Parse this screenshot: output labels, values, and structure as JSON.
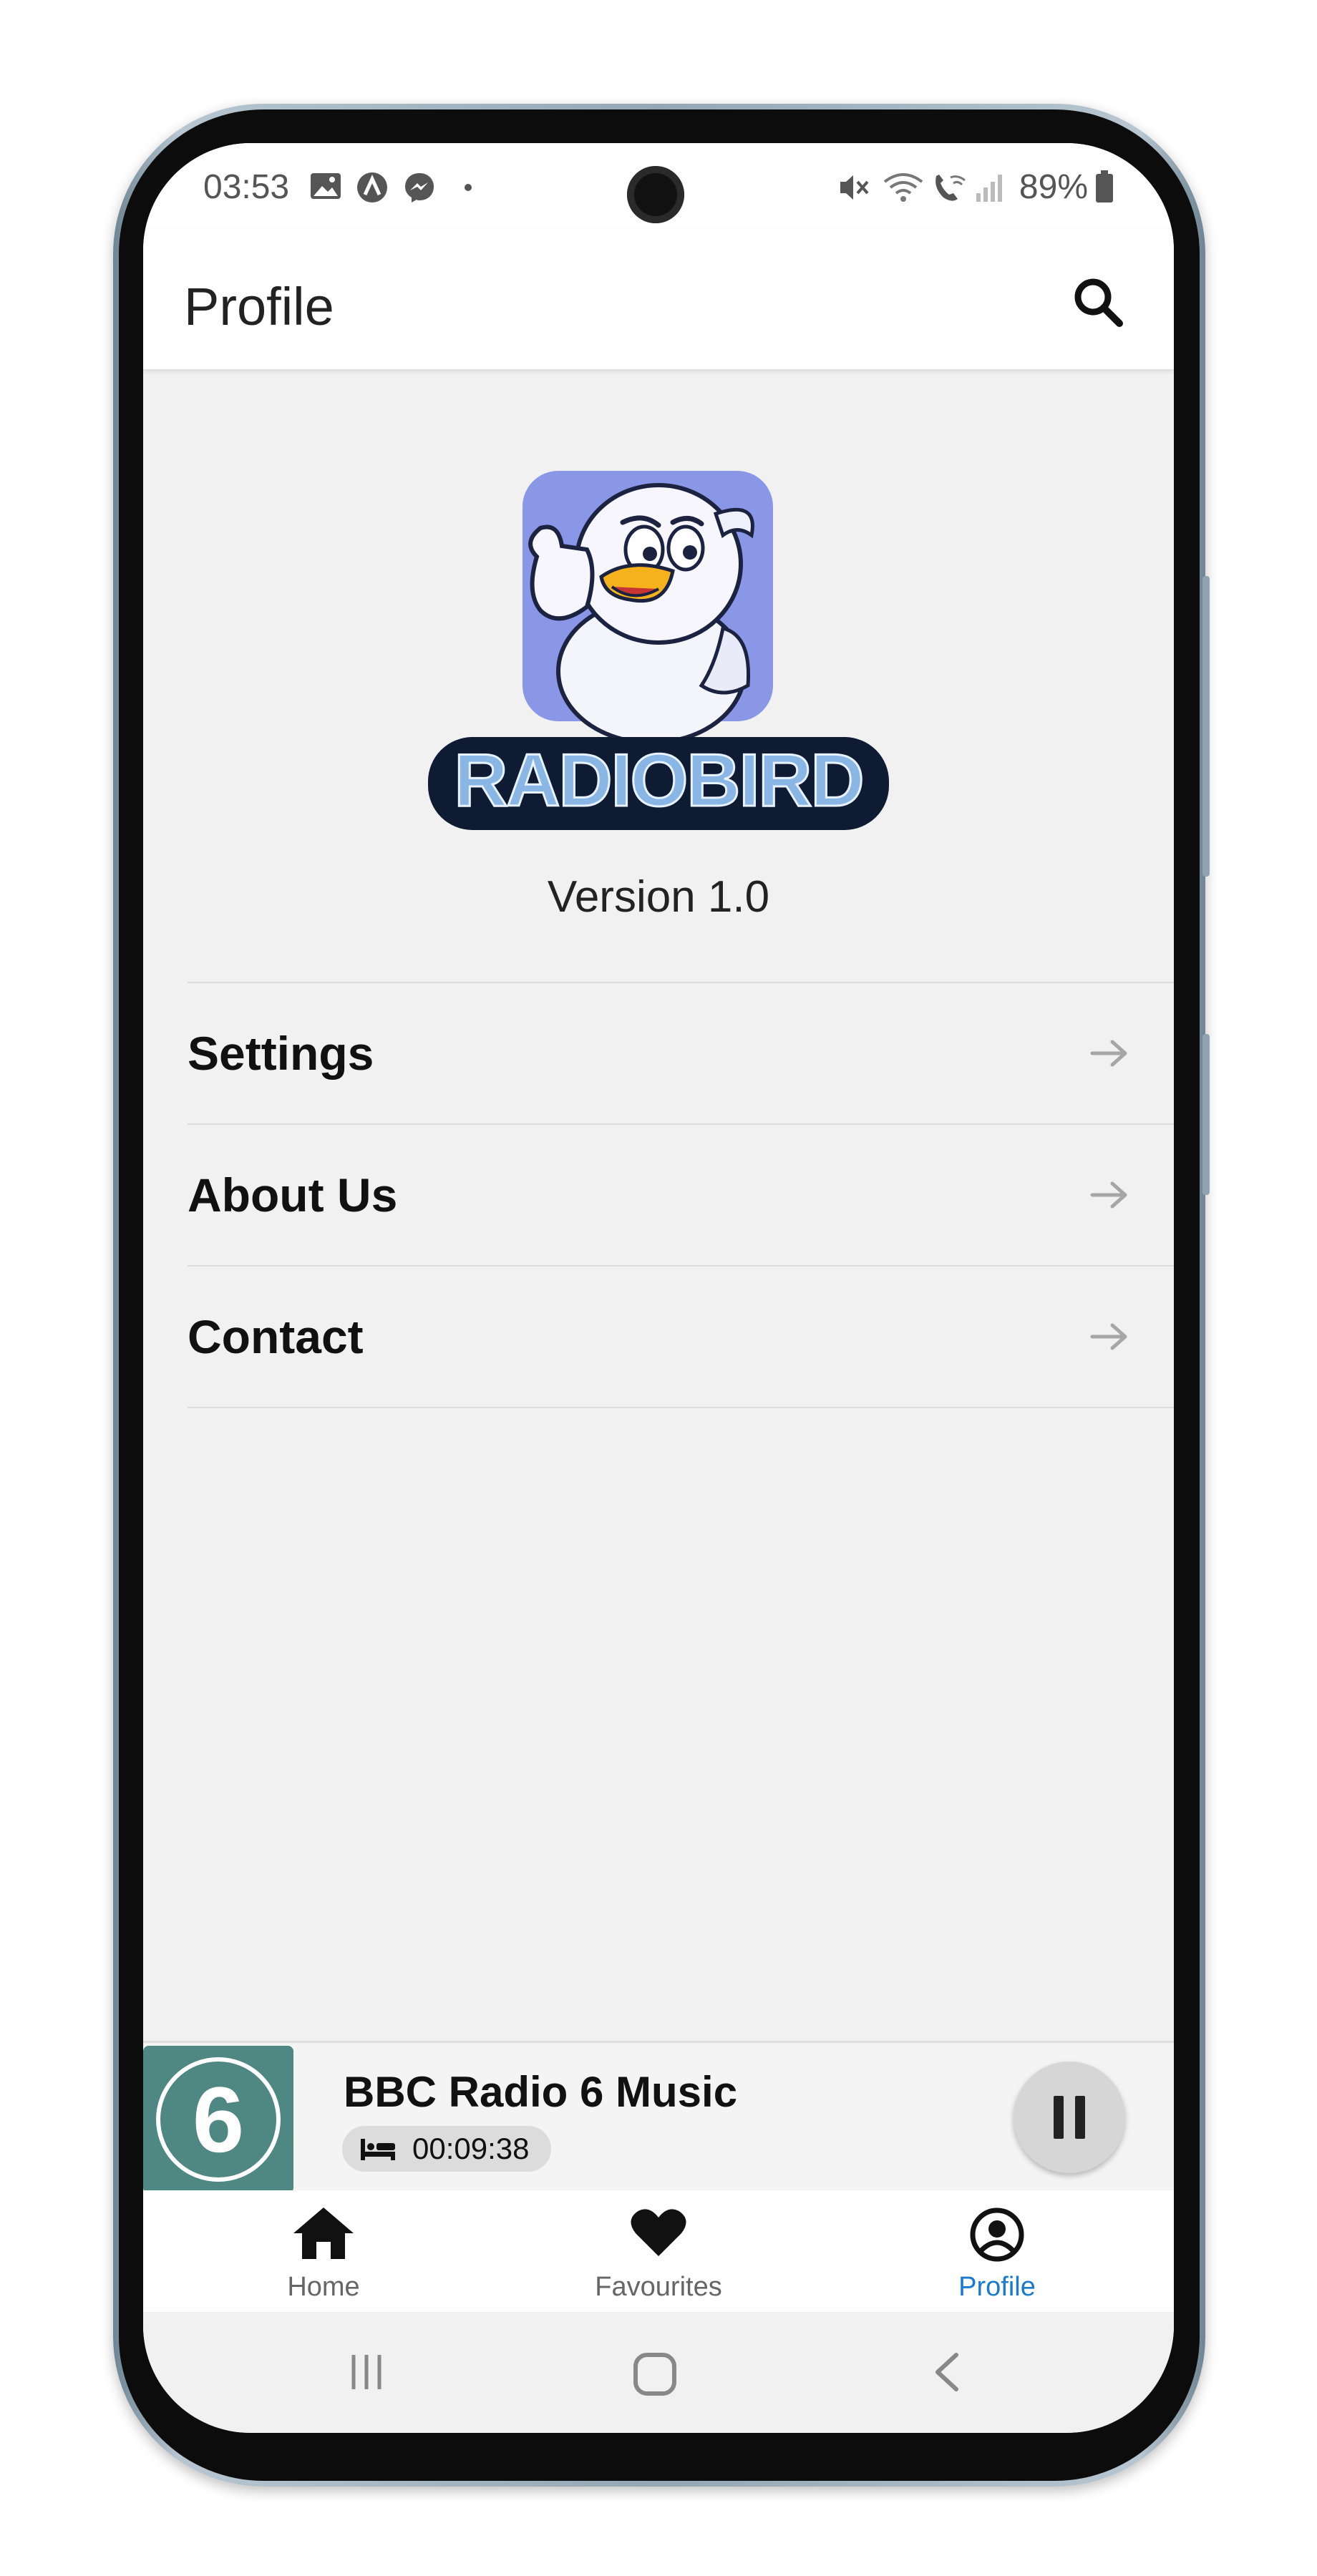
{
  "status_bar": {
    "time": "03:53",
    "battery": "89%",
    "left_icons": [
      "gallery-icon",
      "app-icon",
      "messenger-icon",
      "dot-icon"
    ],
    "right_icons": [
      "mute-icon",
      "wifi-icon",
      "wifi-calling-icon",
      "signal-icon",
      "battery-icon"
    ]
  },
  "app_bar": {
    "title": "Profile",
    "search_icon": "search-icon"
  },
  "about": {
    "logo_text": "RADIOBIRD",
    "version": "Version 1.0"
  },
  "menu": {
    "items": [
      {
        "label": "Settings",
        "icon": "arrow-right-icon"
      },
      {
        "label": "About Us",
        "icon": "arrow-right-icon"
      },
      {
        "label": "Contact",
        "icon": "arrow-right-icon"
      }
    ]
  },
  "player": {
    "station_name": "BBC Radio 6 Music",
    "station_logo_text": "6",
    "sleep_timer": "00:09:38",
    "sleep_icon": "bed-icon",
    "control_icon": "pause-icon"
  },
  "bottom_nav": {
    "items": [
      {
        "label": "Home",
        "icon": "home-icon",
        "active": false
      },
      {
        "label": "Favourites",
        "icon": "heart-icon",
        "active": false
      },
      {
        "label": "Profile",
        "icon": "account-circle-icon",
        "active": true
      }
    ]
  },
  "colors": {
    "active": "#1a7ad0",
    "inactive_label": "#666666",
    "background": "#f1f1f1",
    "station_logo_bg": "#4f8883"
  }
}
